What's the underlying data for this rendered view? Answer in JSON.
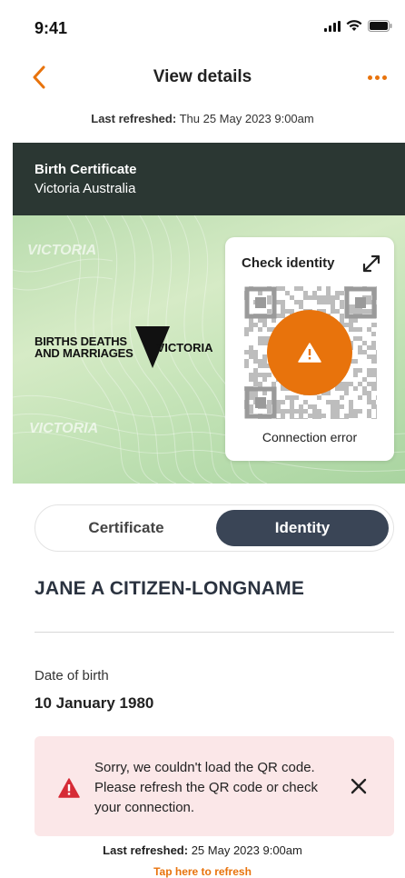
{
  "status_bar": {
    "time": "9:41"
  },
  "nav": {
    "title": "View details",
    "back_icon": "chevron-left-icon",
    "more_icon": "more-dots-icon"
  },
  "top_refresh": {
    "label": "Last refreshed:",
    "value": "Thu 25 May 2023 9:00am"
  },
  "certificate": {
    "title": "Birth Certificate",
    "subtitle": "Victoria Australia",
    "logo_line1": "BIRTHS DEATHS",
    "logo_line2": "AND MARRIAGES",
    "logo_brand": "VICTORIA",
    "watermark": "VICTORIA"
  },
  "qr_panel": {
    "title": "Check identity",
    "status": "Connection error",
    "expand_icon": "expand-icon",
    "warning_icon": "warning-icon"
  },
  "tabs": [
    {
      "label": "Certificate",
      "selected": false
    },
    {
      "label": "Identity",
      "selected": true
    }
  ],
  "person": {
    "name": "JANE A CITIZEN-LONGNAME",
    "dob_label": "Date of birth",
    "dob_value": "10 January 1980"
  },
  "error": {
    "message": "Sorry, we couldn't load the QR code. Please refresh the QR code or check your connection."
  },
  "bottom_refresh": {
    "label": "Last refreshed:",
    "value": "25 May 2023 9:00am",
    "action": "Tap here to refresh"
  },
  "colors": {
    "accent": "#e8730c",
    "header_bg": "#2b3733",
    "tab_selected": "#3a4556",
    "error_bg": "#fbe7e8",
    "error_icon": "#d62b36"
  }
}
